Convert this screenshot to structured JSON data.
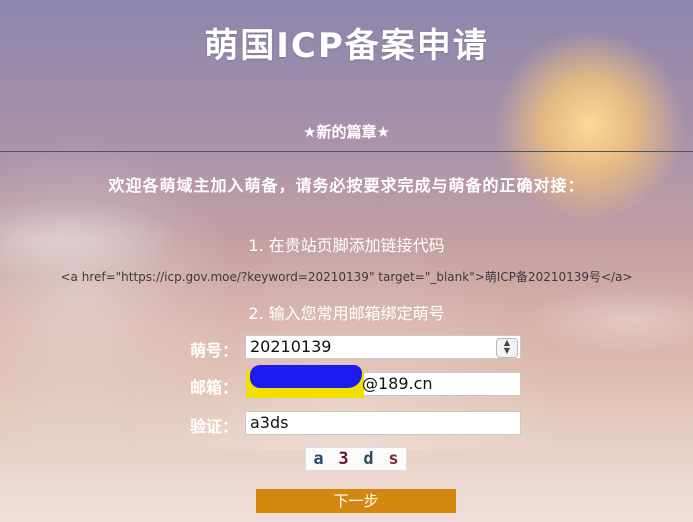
{
  "header": {
    "title": "萌国ICP备案申请",
    "subtitle": "★新的篇章★"
  },
  "intro": {
    "welcome": "欢迎各萌域主加入萌备，请务必按要求完成与萌备的正确对接："
  },
  "step1": {
    "heading": "1. 在贵站页脚添加链接代码",
    "code_snippet": "<a href=\"https://icp.gov.moe/?keyword=20210139\" target=\"_blank\">萌ICP备20210139号</a>"
  },
  "step2": {
    "heading": "2. 输入您常用邮箱绑定萌号"
  },
  "form": {
    "number_label": "萌号：",
    "number_value": "20210139",
    "email_label": "邮箱：",
    "email_visible_value": "@189.cn",
    "verify_label": "验证：",
    "verify_value": "a3ds",
    "captcha_chars": [
      "a",
      "3",
      "d",
      "s"
    ],
    "captcha_colors": [
      "#2b4a6b",
      "#6b1530",
      "#2a4d5a",
      "#7a2a35"
    ],
    "submit_label": "下一步"
  },
  "colors": {
    "submit_bg": "#d4870f",
    "redact_highlight": "#f0e000",
    "redact_ink": "#1c1cf0"
  }
}
